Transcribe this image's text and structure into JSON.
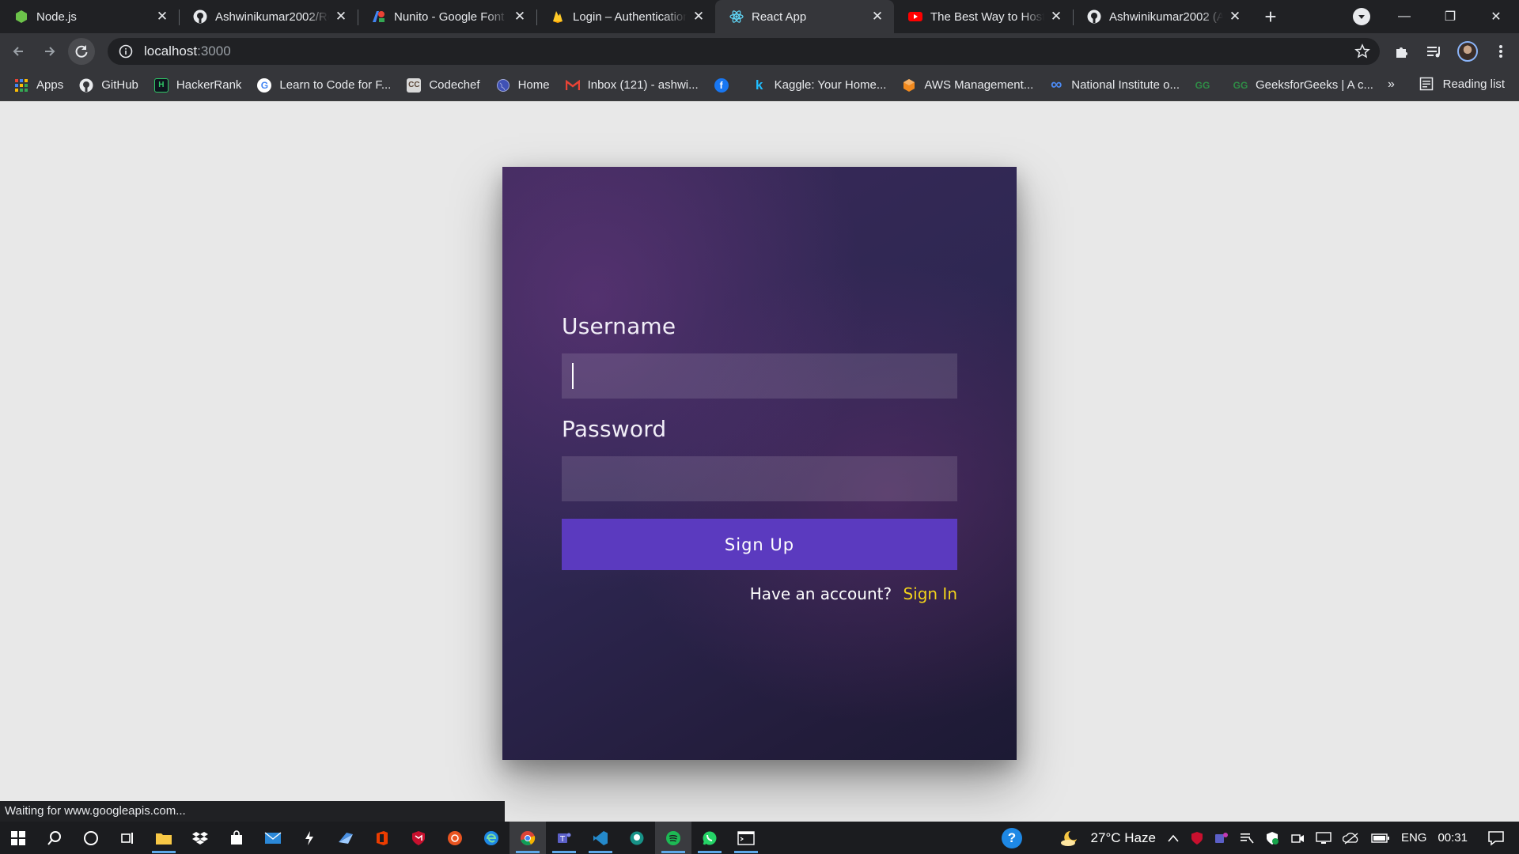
{
  "browser": {
    "tabs": [
      {
        "title": "Node.js",
        "icon": "nodejs-icon",
        "active": false
      },
      {
        "title": "Ashwinikumar2002/Re",
        "icon": "github-icon",
        "active": false
      },
      {
        "title": "Nunito - Google Font",
        "icon": "google-fonts-icon",
        "active": false
      },
      {
        "title": "Login – Authentication",
        "icon": "firebase-icon",
        "active": false
      },
      {
        "title": "React App",
        "icon": "react-icon",
        "active": true
      },
      {
        "title": "The Best Way to Host",
        "icon": "youtube-icon",
        "active": false
      },
      {
        "title": "Ashwinikumar2002 (A",
        "icon": "github-icon",
        "active": false
      }
    ],
    "address": {
      "host": "localhost",
      "port": ":3000"
    },
    "bookmarks": [
      {
        "label": "Apps",
        "icon": "apps-grid-icon"
      },
      {
        "label": "GitHub",
        "icon": "github-icon"
      },
      {
        "label": "HackerRank",
        "icon": "hackerrank-icon"
      },
      {
        "label": "Learn to Code for F...",
        "icon": "google-icon"
      },
      {
        "label": "Codechef",
        "icon": "codechef-icon"
      },
      {
        "label": "Home",
        "icon": "globe-icon"
      },
      {
        "label": "Inbox (121) - ashwi...",
        "icon": "gmail-icon"
      },
      {
        "label": "",
        "icon": "facebook-icon"
      },
      {
        "label": "Kaggle: Your Home...",
        "icon": "kaggle-icon"
      },
      {
        "label": "AWS Management...",
        "icon": "aws-icon"
      },
      {
        "label": "National Institute o...",
        "icon": "infinity-icon"
      },
      {
        "label": "",
        "icon": "gfg-icon"
      },
      {
        "label": "GeeksforGeeks | A c...",
        "icon": "gfg-icon"
      }
    ],
    "bookmarks_more": "»",
    "reading_list": "Reading list",
    "status": "Waiting for www.googleapis.com..."
  },
  "form": {
    "username_label": "Username",
    "username_value": "",
    "password_label": "Password",
    "password_value": "",
    "submit_label": "Sign Up",
    "account_text": "Have an account?",
    "signin_link": "Sign In"
  },
  "colors": {
    "button": "#5b3abf",
    "link": "#f2d21b",
    "card_top": "#3b2a5a",
    "card_bottom": "#1c1a34"
  },
  "taskbar": {
    "weather": "27°C  Haze",
    "language": "ENG",
    "time": "00:31"
  }
}
